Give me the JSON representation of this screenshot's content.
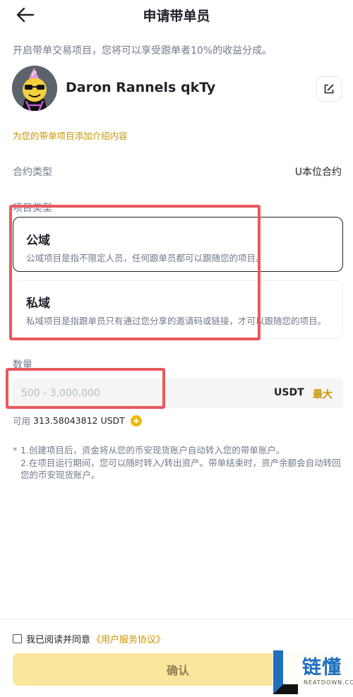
{
  "header": {
    "title": "申请带单员",
    "back_icon": "arrow-left-icon"
  },
  "intro_text": "开启带单交易项目，您将可以享受跟单者10%的收益分成。",
  "profile": {
    "name": "Daron Rannels qkTy",
    "edit_icon": "edit-icon"
  },
  "add_intro_link": "为您的带单项目添加介绍内容",
  "contract": {
    "label": "合约类型",
    "value": "U本位合约"
  },
  "project_type": {
    "label": "项目类型",
    "options": [
      {
        "title": "公域",
        "desc": "公域项目是指不限定人员，任何跟单员都可以跟随您的项目。",
        "selected": true
      },
      {
        "title": "私域",
        "desc": "私域项目是指跟单员只有通过您分享的邀请码或链接，才可以跟随您的项目。",
        "selected": false
      }
    ]
  },
  "quantity": {
    "label": "数量",
    "placeholder": "500 - 3,000,000",
    "unit": "USDT",
    "max_label": "最大"
  },
  "available": {
    "label": "可用",
    "value": "313.58043812 USDT",
    "icon": "plus-circle-icon"
  },
  "notes": {
    "marker": "*",
    "lines": [
      "1.创建项目后，资金将从您的币安现货账户自动转入您的带单账户。",
      "2.在项目运行期间，您可以随时转入/转出资产。带单结束时，资产余额会自动转回您的币安现货账户。"
    ]
  },
  "agreement": {
    "text": "我已阅读并同意",
    "link": "《用户服务协议》"
  },
  "confirm_label": "确认",
  "watermark": {
    "text": "链懂",
    "sub": "NEATDOWN.COM"
  },
  "colors": {
    "accent": "#c99400",
    "brand_yellow": "#f0b90b",
    "button_disabled": "#fbe69d",
    "highlight": "#e8595c"
  }
}
